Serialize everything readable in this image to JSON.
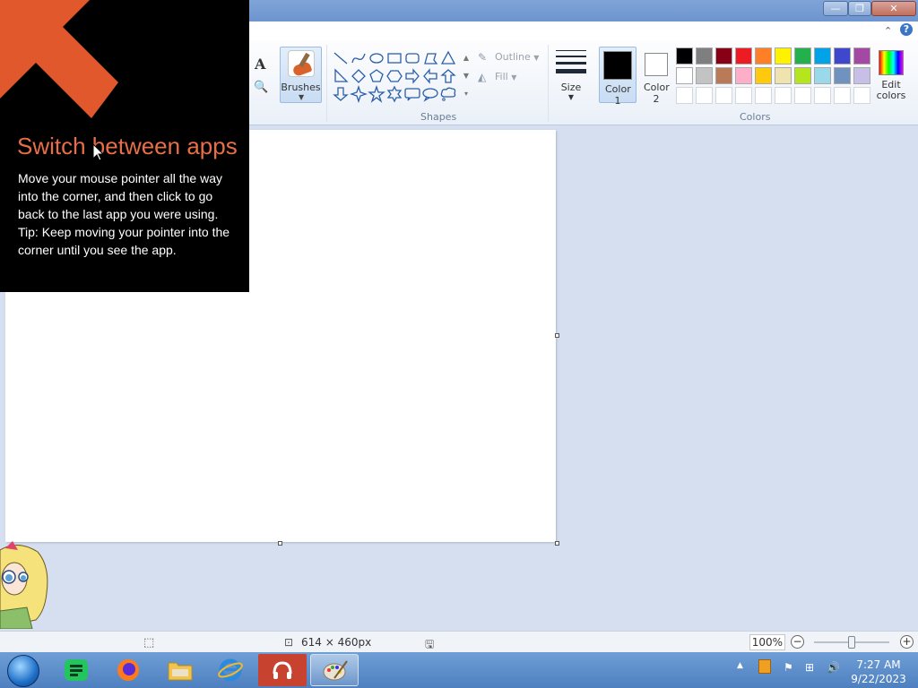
{
  "window": {
    "controls": {
      "minimize": "—",
      "maximize": "❐",
      "close": "✕"
    }
  },
  "ribbon": {
    "tools": {
      "text_glyph": "A",
      "magnifier_glyph": "🔍"
    },
    "brushes_label": "Brushes",
    "shapes_label": "Shapes",
    "outline_label": "Outline",
    "fill_label": "Fill",
    "size_label": "Size",
    "color1_label": "Color 1",
    "color2_label": "Color 2",
    "colors_label": "Colors",
    "edit_colors_label": "Edit colors",
    "color1_value": "#000000",
    "color2_value": "#ffffff",
    "palette_rows": [
      [
        "#000000",
        "#7f7f7f",
        "#880015",
        "#ed1c24",
        "#ff7f27",
        "#fff200",
        "#22b14c",
        "#00a2e8",
        "#3f48cc",
        "#a349a4"
      ],
      [
        "#ffffff",
        "#c3c3c3",
        "#b97a57",
        "#ffaec9",
        "#ffc90e",
        "#efe4b0",
        "#b5e61d",
        "#99d9ea",
        "#7092be",
        "#c8bfe7"
      ],
      [
        "#ffffff",
        "#ffffff",
        "#ffffff",
        "#ffffff",
        "#ffffff",
        "#ffffff",
        "#ffffff",
        "#ffffff",
        "#ffffff",
        "#ffffff"
      ]
    ],
    "shapes": [
      "line",
      "curve",
      "oval",
      "rectangle",
      "rounded-rectangle",
      "polygon",
      "triangle",
      "right-triangle",
      "diamond",
      "pentagon",
      "hexagon",
      "right-arrow",
      "left-arrow",
      "up-arrow",
      "down-arrow",
      "four-point-star",
      "five-point-star",
      "six-point-star",
      "rounded-callout",
      "oval-callout",
      "cloud-callout"
    ]
  },
  "charm_tip": {
    "title": "Switch between apps",
    "body": "Move your mouse pointer all the way into the corner, and then click to go back to the last app you were using.",
    "tip": "Tip: Keep moving your pointer into the corner until you see the app."
  },
  "status": {
    "dimensions": "614 × 460px",
    "zoom": "100%"
  },
  "taskbar": {
    "apps": [
      "chat-app",
      "firefox",
      "file-explorer",
      "internet-explorer",
      "music-app",
      "paint"
    ],
    "active_app": "paint"
  },
  "clock": {
    "time": "7:27 AM",
    "date": "9/22/2023"
  },
  "colors": {
    "accent_orange": "#e86e47",
    "taskbar_blue": "#5a8ccb"
  }
}
